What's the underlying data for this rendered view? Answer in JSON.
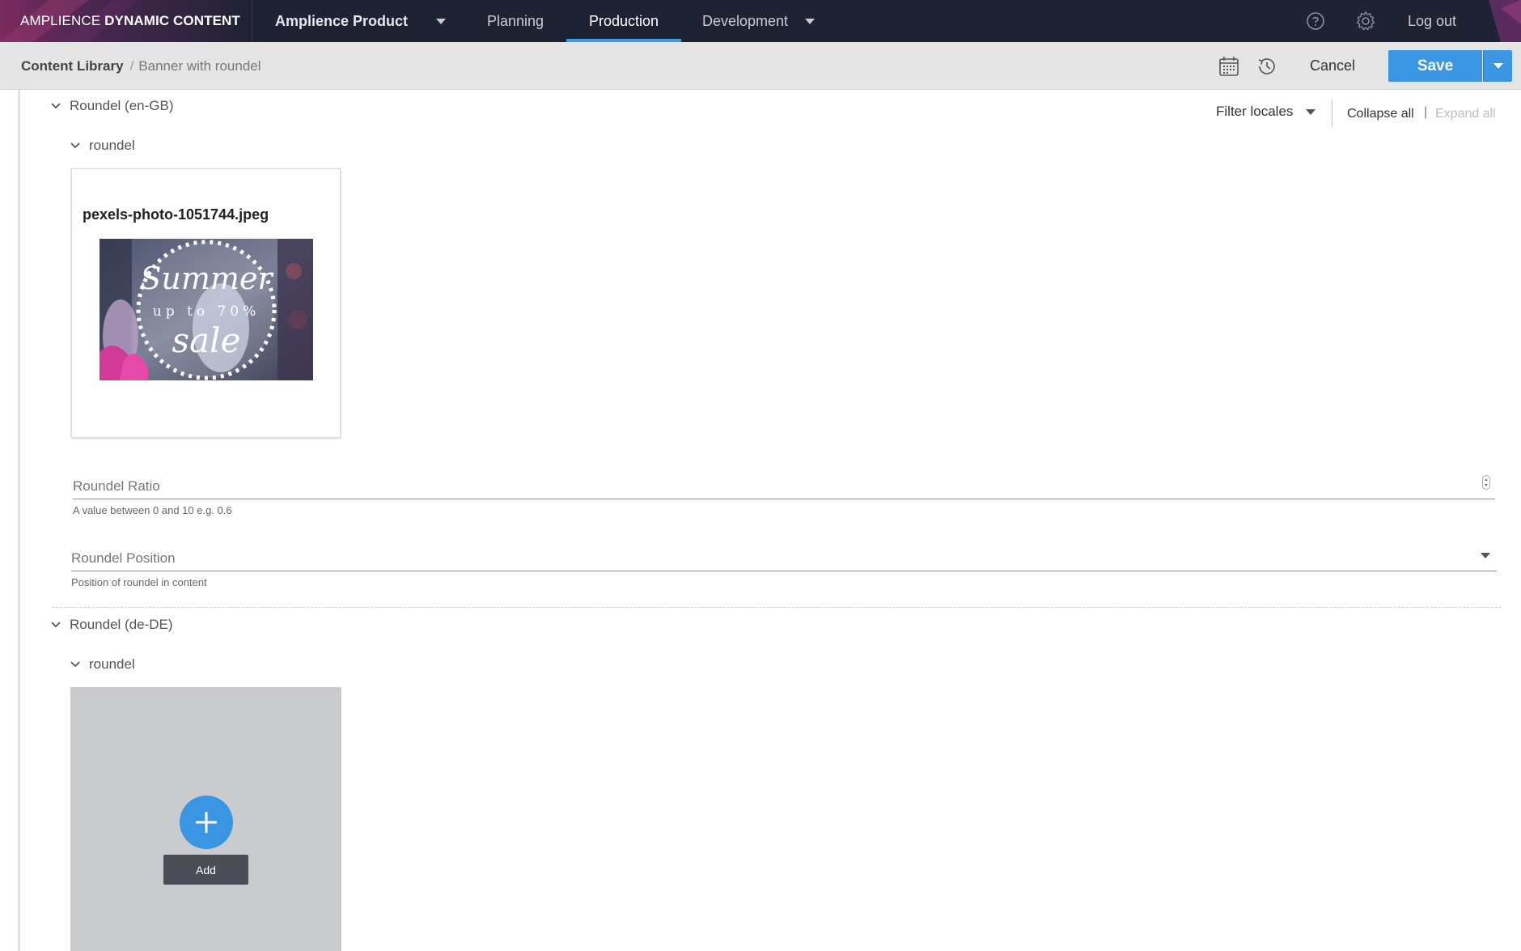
{
  "topnav": {
    "brand_light": "AMPLIENCE",
    "brand_bold": "DYNAMIC CONTENT",
    "hub": "Amplience Product",
    "tabs": [
      {
        "label": "Planning"
      },
      {
        "label": "Production"
      },
      {
        "label": "Development"
      }
    ],
    "active_tab": "Production",
    "logout": "Log out"
  },
  "subheader": {
    "breadcrumb_root": "Content Library",
    "breadcrumb_separator": "/",
    "breadcrumb_current": "Banner with roundel",
    "cancel": "Cancel",
    "save": "Save"
  },
  "toolbar": {
    "filter_locales": "Filter locales",
    "collapse_all": "Collapse all",
    "separator": "|",
    "expand_all": "Expand all"
  },
  "sections": [
    {
      "title": "Roundel (en-GB)",
      "subsection": "roundel",
      "image": {
        "filename": "pexels-photo-1051744.jpeg",
        "thumb_text_1": "Summer",
        "thumb_text_2": "up to 70%",
        "thumb_text_3": "sale"
      },
      "fields": [
        {
          "label": "Roundel Ratio",
          "help": "A value between 0 and 10 e.g. 0.6"
        },
        {
          "label": "Roundel Position",
          "help": "Position of roundel in content"
        }
      ]
    },
    {
      "title": "Roundel (de-DE)",
      "subsection": "roundel",
      "add_label": "Add"
    }
  ],
  "colors": {
    "topbar": "#1f2233",
    "accent": "#3a95e3",
    "add_card": "#cacbce"
  }
}
